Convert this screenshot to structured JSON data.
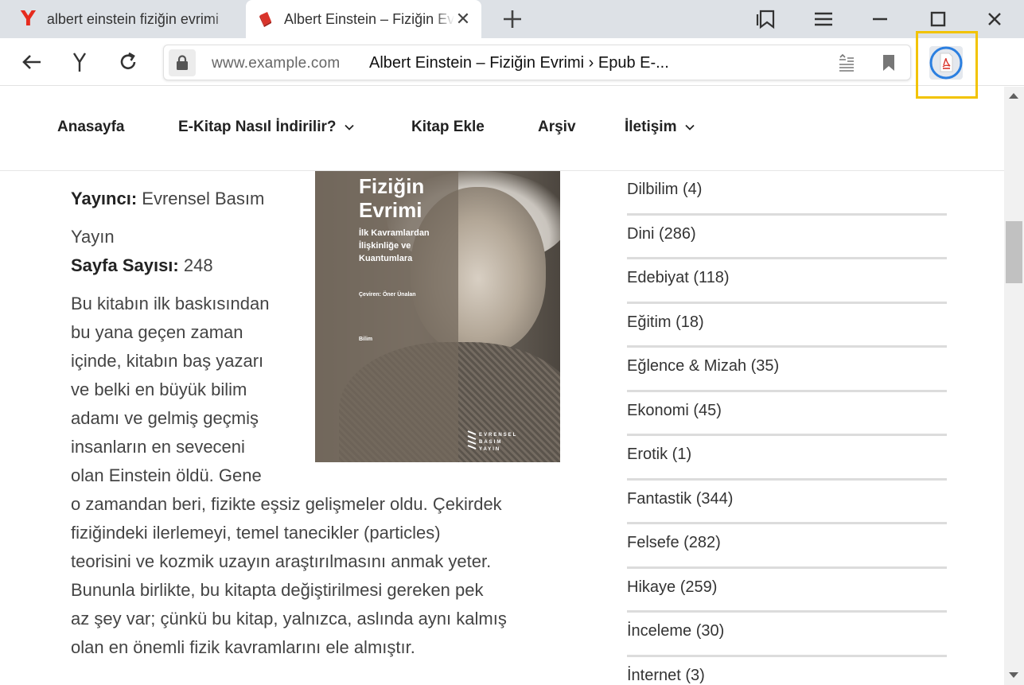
{
  "browser": {
    "tabs": [
      {
        "title": "albert einstein fiziğin evrimi"
      },
      {
        "title": "Albert Einstein – Fiziğin Evrimi"
      }
    ],
    "url_domain": "www.example.com",
    "url_title": "Albert Einstein – Fiziğin Evrimi › Epub E-...",
    "yandex_glyph": "Y",
    "colors": {
      "highlight": "#f2c300",
      "yandex_red": "#e62b1e",
      "tab_bar": "#dde1e6"
    }
  },
  "site_nav": {
    "items": [
      {
        "label": "Anasayfa"
      },
      {
        "label": "E-Kitap Nasıl İndirilir?"
      },
      {
        "label": "Kitap Ekle"
      },
      {
        "label": "Arşiv"
      },
      {
        "label": "İletişim"
      }
    ]
  },
  "book": {
    "publisher_label": "Yayıncı:",
    "publisher_value": "Evrensel Basım",
    "publisher_value_cont": "Yayın",
    "pages_label": "Sayfa Sayısı:",
    "pages_value": "248",
    "description_narrow": [
      "Bu kitabın ilk baskısından",
      "bu yana geçen zaman",
      "içinde, kitabın baş yazarı",
      "ve belki en büyük bilim",
      "adamı ve gelmiş geçmiş",
      "insanların en seveceni",
      "olan Einstein öldü. Gene"
    ],
    "description_wide": [
      "o zamandan beri, fizikte eşsiz gelişmeler oldu. Çekirdek",
      "fiziğindeki ilerlemeyi, temel tanecikler (particles)",
      "teorisini ve kozmik uzayın araştırılmasını anmak yeter.",
      "Bununla birlikte, bu kitapta değiştirilmesi gereken pek",
      "az şey var; çünkü bu kitap, yalnızca, aslında aynı kalmış",
      "olan en önemli fizik kavramlarını ele almıştır."
    ],
    "cover": {
      "title_line1": "Fiziğin",
      "title_line2": "Evrimi",
      "subtitle_line1": "İlk Kavramlardan",
      "subtitle_line2": "İlişkinliğe ve",
      "subtitle_line3": "Kuantumlara",
      "translator": "Çeviren: Öner Ünalan",
      "genre": "Bilim",
      "publisher_line1": "EVRENSEL",
      "publisher_line2": "BASIM",
      "publisher_line3": "YAYIN"
    }
  },
  "categories": [
    {
      "label": "Dilbilim (4)"
    },
    {
      "label": "Dini (286)"
    },
    {
      "label": "Edebiyat (118)"
    },
    {
      "label": "Eğitim (18)"
    },
    {
      "label": "Eğlence & Mizah (35)"
    },
    {
      "label": "Ekonomi (45)"
    },
    {
      "label": "Erotik (1)"
    },
    {
      "label": "Fantastik (344)"
    },
    {
      "label": "Felsefe (282)"
    },
    {
      "label": "Hikaye (259)"
    },
    {
      "label": "İnceleme (30)"
    },
    {
      "label": "İnternet (3)"
    }
  ]
}
